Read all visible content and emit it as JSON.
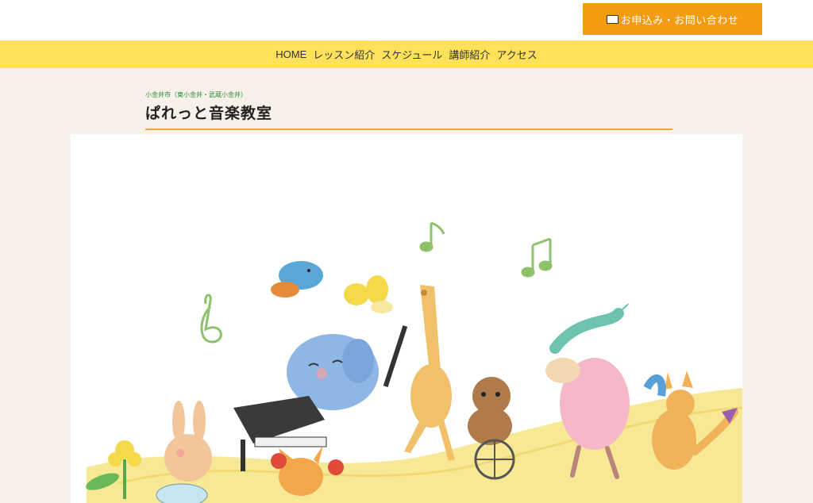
{
  "header": {
    "contact_label": "お申込み・お問い合わせ"
  },
  "nav": {
    "items": [
      "HOME",
      "レッスン紹介",
      "スケジュール",
      "講師紹介",
      "アクセス"
    ]
  },
  "site": {
    "subtitle": "小金井市（東小金井・武蔵小金井）",
    "title": "ぱれっと音楽教室"
  },
  "colors": {
    "accent_orange": "#f39c12",
    "nav_yellow": "#ffe15a",
    "background": "#f8f1ea",
    "subtitle_green": "#2e8b3a"
  },
  "icons": [
    "mail-icon"
  ]
}
